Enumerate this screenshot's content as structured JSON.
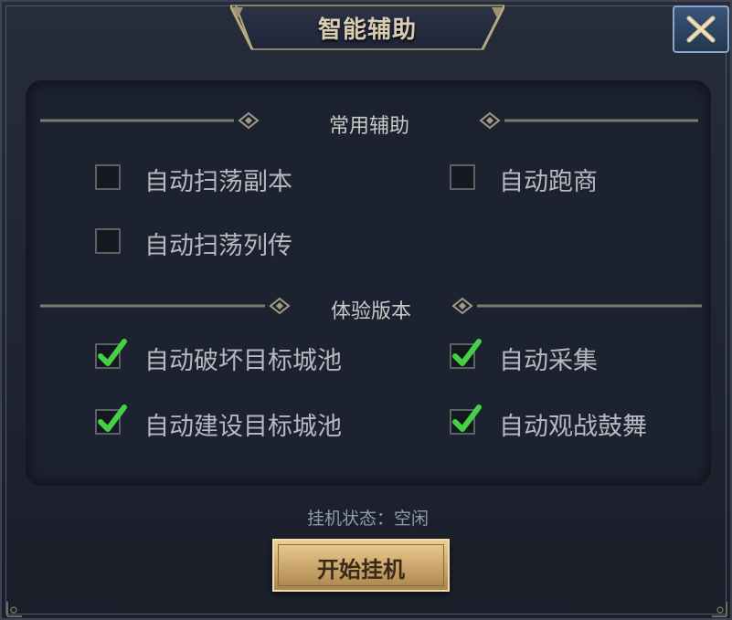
{
  "window": {
    "title": "智能辅助"
  },
  "sections": [
    {
      "title": "常用辅助",
      "options": [
        {
          "label": "自动扫荡副本",
          "checked": false
        },
        {
          "label": "自动跑商",
          "checked": false
        },
        {
          "label": "自动扫荡列传",
          "checked": false
        }
      ]
    },
    {
      "title": "体验版本",
      "options": [
        {
          "label": "自动破坏目标城池",
          "checked": true
        },
        {
          "label": "自动采集",
          "checked": true
        },
        {
          "label": "自动建设目标城池",
          "checked": true
        },
        {
          "label": "自动观战鼓舞",
          "checked": true
        }
      ]
    }
  ],
  "status": {
    "text": "挂机状态：空闲"
  },
  "start_button": {
    "label": "开始挂机"
  },
  "icons": {
    "close": "close-cross-icon",
    "check": "check-mark-icon",
    "divider_ornament": "diamond-ornament-icon"
  },
  "colors": {
    "accent_gold": "#d7b57a",
    "check_green": "#4dd64a",
    "panel_bg": "#1c2230"
  }
}
